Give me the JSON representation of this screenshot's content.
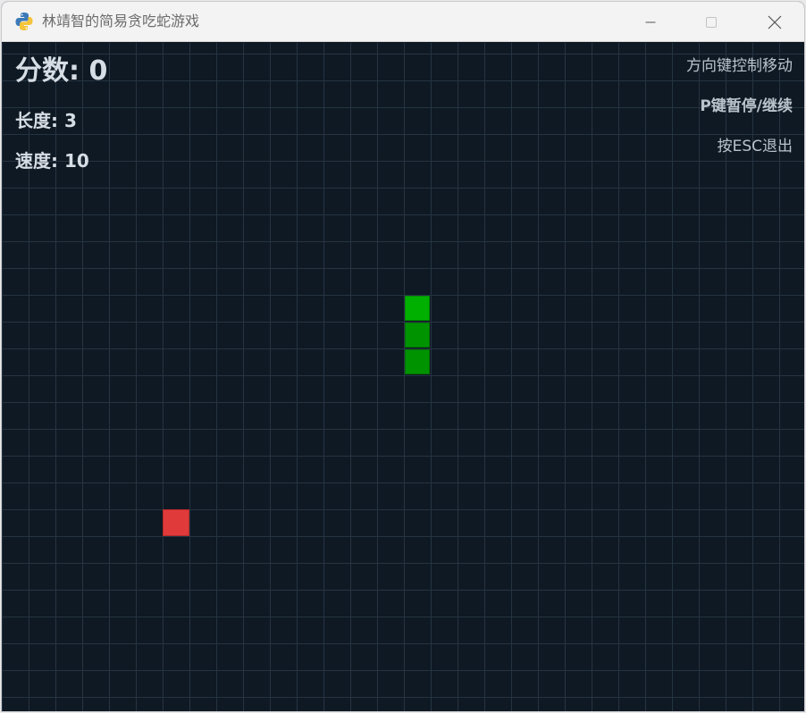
{
  "window": {
    "title": "林靖智的简易贪吃蛇游戏",
    "icon": "python-icon",
    "controls": {
      "minimize": "minimize-icon",
      "maximize": "maximize-icon",
      "close": "close-icon"
    }
  },
  "hud": {
    "score_text": "分数: 0",
    "length_text": "长度: 3",
    "speed_text": "速度: 10",
    "hint_controls": "方向键控制移动",
    "hint_pause": "P键暂停/继续",
    "hint_quit": "按ESC退出"
  },
  "game": {
    "score": 0,
    "length": 3,
    "speed": 10,
    "cell_size_note": "grid",
    "snake": [
      {
        "col": 15,
        "row": 9,
        "part": "head"
      },
      {
        "col": 15,
        "row": 10,
        "part": "body"
      },
      {
        "col": 15,
        "row": 11,
        "part": "body"
      }
    ],
    "food": {
      "col": 6,
      "row": 17
    }
  },
  "colors": {
    "background": "#0f1923",
    "grid_line": "#253442",
    "snake_head": "#00b000",
    "snake_body": "#009300",
    "food": "#e03a3a",
    "hud_text": "#d6dde4"
  }
}
